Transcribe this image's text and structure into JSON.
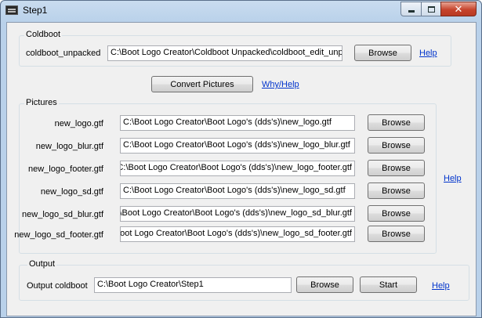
{
  "window": {
    "title": "Step1"
  },
  "coldboot": {
    "group_label": "Coldboot",
    "field_label": "coldboot_unpacked",
    "value": "C:\\Boot Logo Creator\\Coldboot Unpacked\\coldboot_edit_unp",
    "browse_label": "Browse",
    "help_label": "Help"
  },
  "convert": {
    "button_label": "Convert Pictures",
    "link_label": "Why/Help"
  },
  "pictures": {
    "group_label": "Pictures",
    "help_label": "Help",
    "browse_label": "Browse",
    "items": [
      {
        "label": "new_logo.gtf",
        "value": "C:\\Boot Logo Creator\\Boot Logo's (dds's)\\new_logo.gtf"
      },
      {
        "label": "new_logo_blur.gtf",
        "value": "C:\\Boot Logo Creator\\Boot Logo's (dds's)\\new_logo_blur.gtf"
      },
      {
        "label": "new_logo_footer.gtf",
        "value": "C:\\Boot Logo Creator\\Boot Logo's (dds's)\\new_logo_footer.gtf"
      },
      {
        "label": "new_logo_sd.gtf",
        "value": "C:\\Boot Logo Creator\\Boot Logo's (dds's)\\new_logo_sd.gtf"
      },
      {
        "label": "new_logo_sd_blur.gtf",
        "value": "C:\\Boot Logo Creator\\Boot Logo's (dds's)\\new_logo_sd_blur.gtf"
      },
      {
        "label": "new_logo_sd_footer.gtf",
        "value": "C:\\Boot Logo Creator\\Boot Logo's (dds's)\\new_logo_sd_footer.gtf"
      }
    ]
  },
  "output": {
    "group_label": "Output",
    "field_label": "Output coldboot",
    "value": "C:\\Boot Logo Creator\\Step1",
    "browse_label": "Browse",
    "start_label": "Start",
    "help_label": "Help"
  }
}
